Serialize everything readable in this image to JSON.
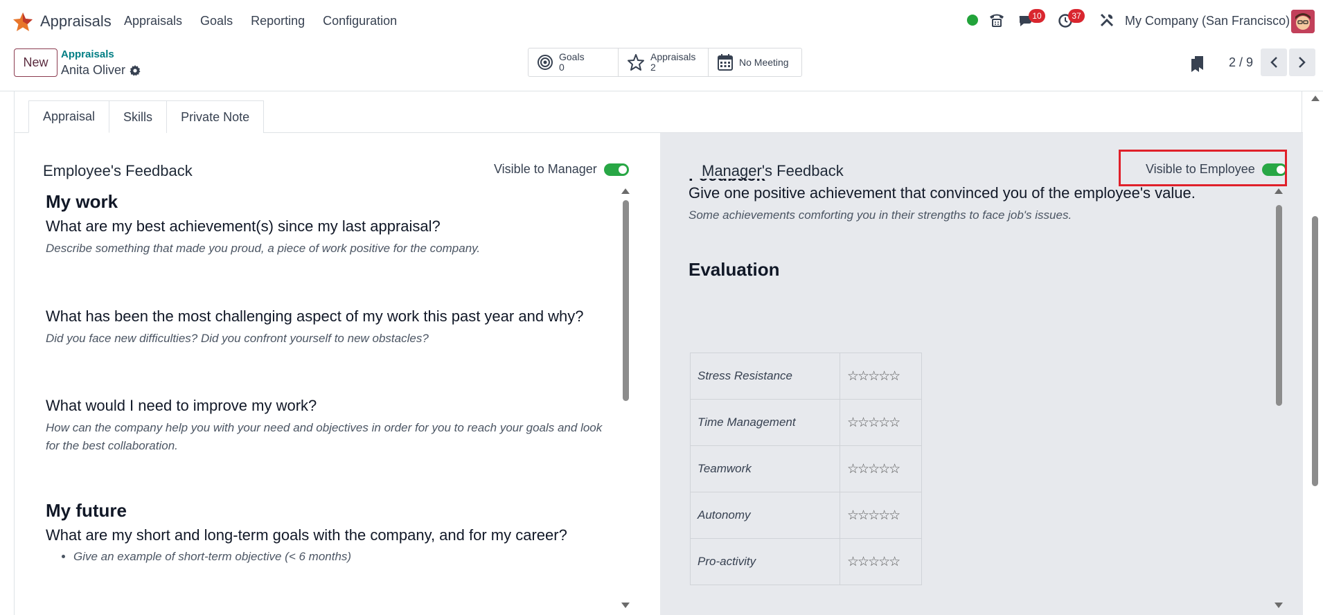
{
  "app": {
    "name": "Appraisals"
  },
  "menu": [
    "Appraisals",
    "Goals",
    "Reporting",
    "Configuration"
  ],
  "systray": {
    "messages_badge": "10",
    "activities_badge": "37",
    "company": "My Company (San Francisco)"
  },
  "control": {
    "new_label": "New",
    "breadcrumb_parent": "Appraisals",
    "breadcrumb_current": "Anita Oliver",
    "smart_buttons": [
      {
        "label": "Goals",
        "value": "0",
        "icon": "target-icon"
      },
      {
        "label": "Appraisals",
        "value": "2",
        "icon": "star-icon"
      },
      {
        "label": "No Meeting",
        "value": "",
        "icon": "calendar-icon"
      }
    ],
    "pager": "2 / 9"
  },
  "tabs": [
    "Appraisal",
    "Skills",
    "Private Note"
  ],
  "employee": {
    "title": "Employee's Feedback",
    "toggle_label": "Visible to Manager",
    "toggle_on": true,
    "sections": {
      "my_work": "My work",
      "q1": "What are my best achievement(s) since my last appraisal?",
      "h1": "Describe something that made you proud, a piece of work positive for the company.",
      "q2": "What has been the most challenging aspect of my work this past year and why?",
      "h2": "Did you face new difficulties? Did you confront yourself to new obstacles?",
      "q3": "What would I need to improve my work?",
      "h3": "How can the company help you with your need and objectives in order for you to reach your goals and look for the best collaboration.",
      "my_future": "My future",
      "q4": "What are my short and long-term goals with the company, and for my career?",
      "b1": "Give an example of short-term objective (< 6 months)"
    }
  },
  "manager": {
    "title": "Manager's Feedback",
    "toggle_label": "Visible to Employee",
    "toggle_on": true,
    "cut_heading": "Feedback",
    "q1": "Give one positive achievement that convinced you of the employee's value.",
    "h1": "Some achievements comforting you in their strengths to face job's issues.",
    "evaluation": "Evaluation",
    "criteria": [
      {
        "name": "Stress Resistance",
        "stars": "☆☆☆☆☆"
      },
      {
        "name": "Time Management",
        "stars": "☆☆☆☆☆"
      },
      {
        "name": "Teamwork",
        "stars": "☆☆☆☆☆"
      },
      {
        "name": "Autonomy",
        "stars": "☆☆☆☆☆"
      },
      {
        "name": "Pro-activity",
        "stars": "☆☆☆☆☆"
      }
    ]
  },
  "colors": {
    "brand": "#714b67",
    "toggle": "#28a745",
    "badge": "#d9262f",
    "highlight": "#e0202a",
    "link": "#017e84"
  }
}
